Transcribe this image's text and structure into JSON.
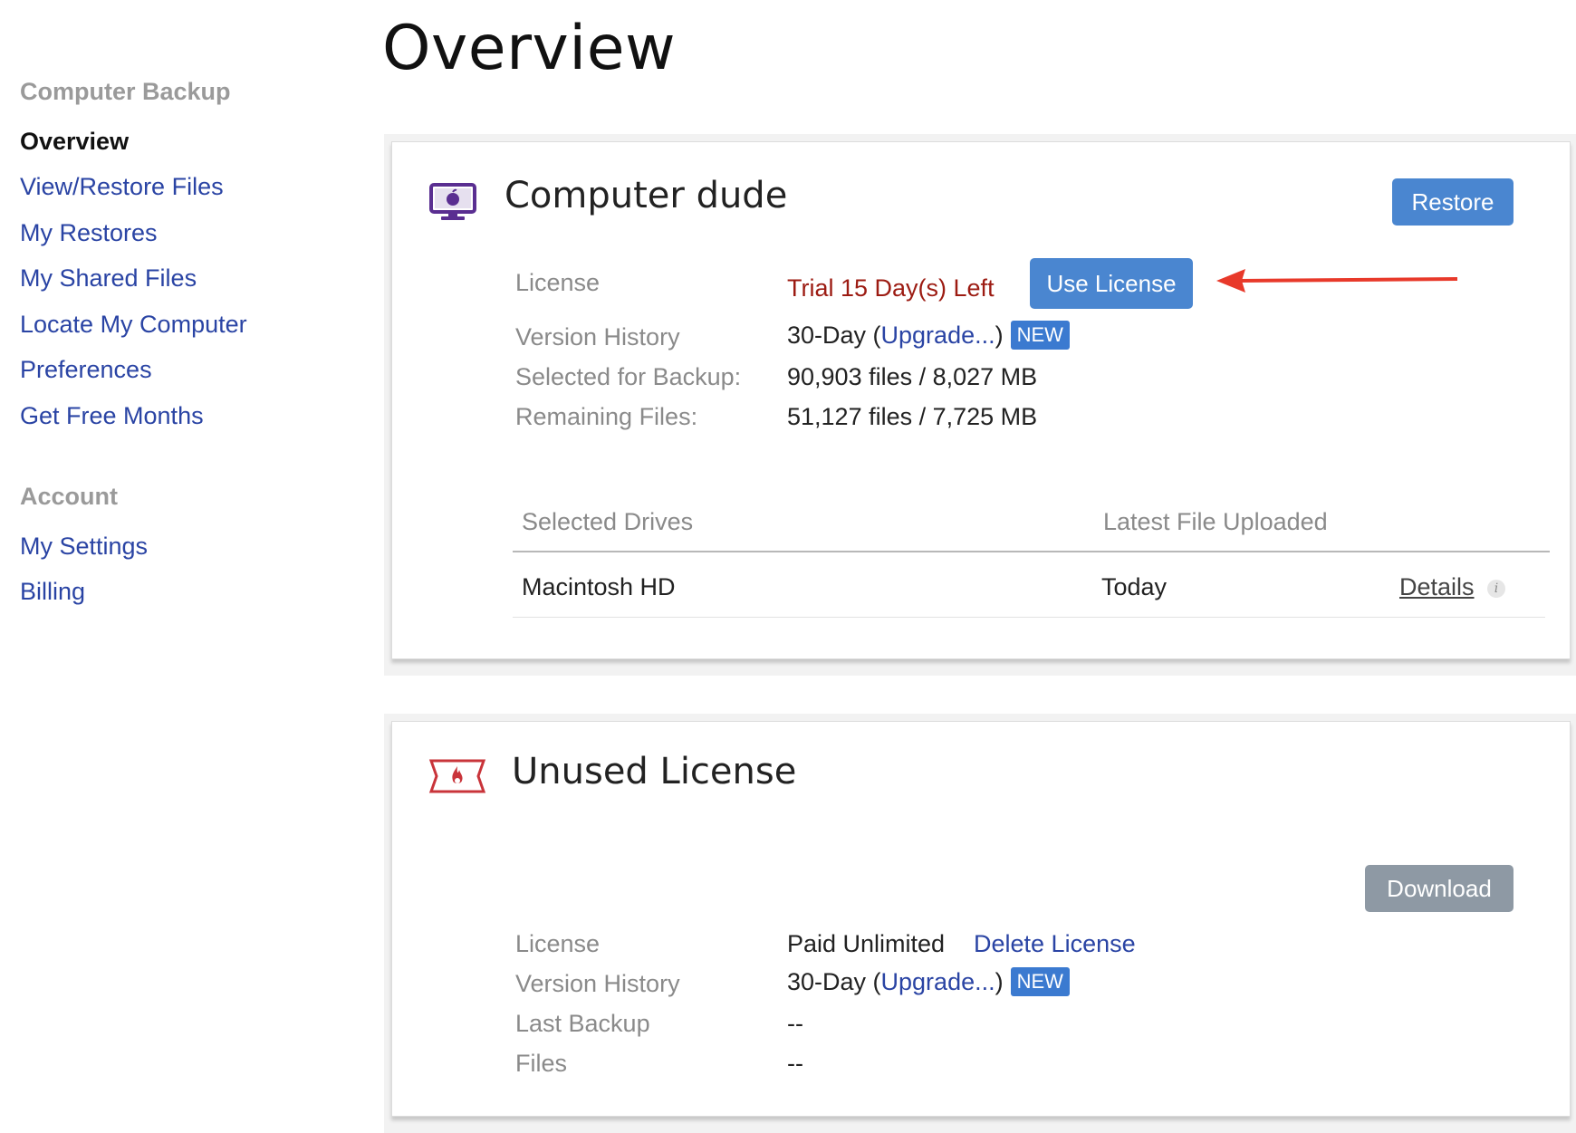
{
  "page": {
    "title": "Overview"
  },
  "sidebar": {
    "section1": "Computer Backup",
    "items1": [
      "Overview",
      "View/Restore Files",
      "My Restores",
      "My Shared Files",
      "Locate My Computer",
      "Preferences",
      "Get Free Months"
    ],
    "section2": "Account",
    "items2": [
      "My Settings",
      "Billing"
    ]
  },
  "computer_card": {
    "title": "Computer dude",
    "icon": "monitor-apple-icon",
    "restore_label": "Restore",
    "license_label": "License",
    "license_value": "Trial 15 Day(s) Left",
    "use_license_label": "Use License",
    "version_label": "Version History",
    "version_prefix": "30-Day (",
    "upgrade_link": "Upgrade...",
    "version_suffix": ")",
    "new_badge": "NEW",
    "selected_label": "Selected for Backup:",
    "selected_value": "90,903 files / 8,027 MB",
    "remaining_label": "Remaining Files:",
    "remaining_value": "51,127 files / 7,725 MB",
    "table": {
      "col_drives": "Selected Drives",
      "col_latest": "Latest File Uploaded",
      "rows": [
        {
          "drive": "Macintosh HD",
          "latest": "Today",
          "details": "Details"
        }
      ]
    }
  },
  "license_card": {
    "title": "Unused License",
    "icon": "ticket-flame-icon",
    "download_label": "Download",
    "license_label": "License",
    "license_value": "Paid Unlimited",
    "delete_link": "Delete License",
    "version_label": "Version History",
    "version_prefix": "30-Day (",
    "upgrade_link": "Upgrade...",
    "version_suffix": ")",
    "new_badge": "NEW",
    "last_backup_label": "Last Backup",
    "last_backup_value": "--",
    "files_label": "Files",
    "files_value": "--"
  },
  "colors": {
    "link": "#2a44a4",
    "trial": "#9c1b12",
    "button_blue": "#4a86d0",
    "button_gray": "#8e99a4",
    "arrow": "#e8392a",
    "icon_purple": "#5a2e91",
    "icon_red": "#c9343a"
  }
}
